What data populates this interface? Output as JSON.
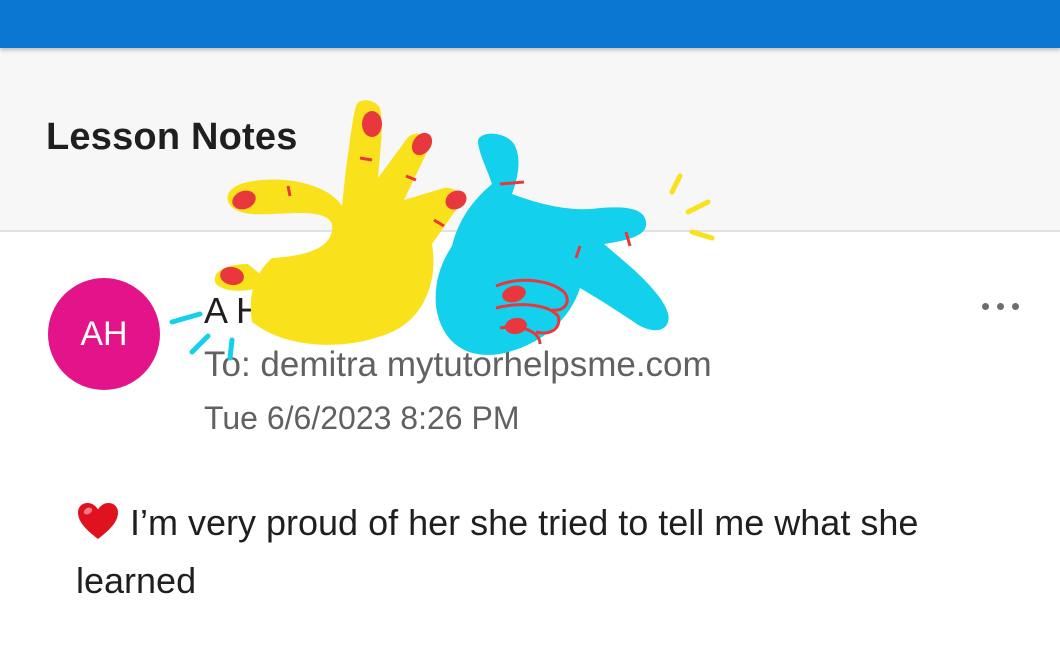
{
  "subject": {
    "title": "Lesson Notes"
  },
  "message": {
    "avatar_initials": "AH",
    "sender_name": "A      H",
    "recipient": "To: demitra mytutorhelpsme.com",
    "timestamp": "Tue 6/6/2023 8:26 PM",
    "body": "I’m very proud of her she tried to tell me what she learned",
    "body_emoji_icon": "red-heart-icon",
    "more_icon": "more-options-icon"
  },
  "colors": {
    "top_bar": "#0a76d1",
    "avatar": "#e3138a",
    "sticker_yellow_hand": "#f9e21c",
    "sticker_blue_hand": "#13d0ec",
    "sticker_nail_red": "#e8383e"
  }
}
